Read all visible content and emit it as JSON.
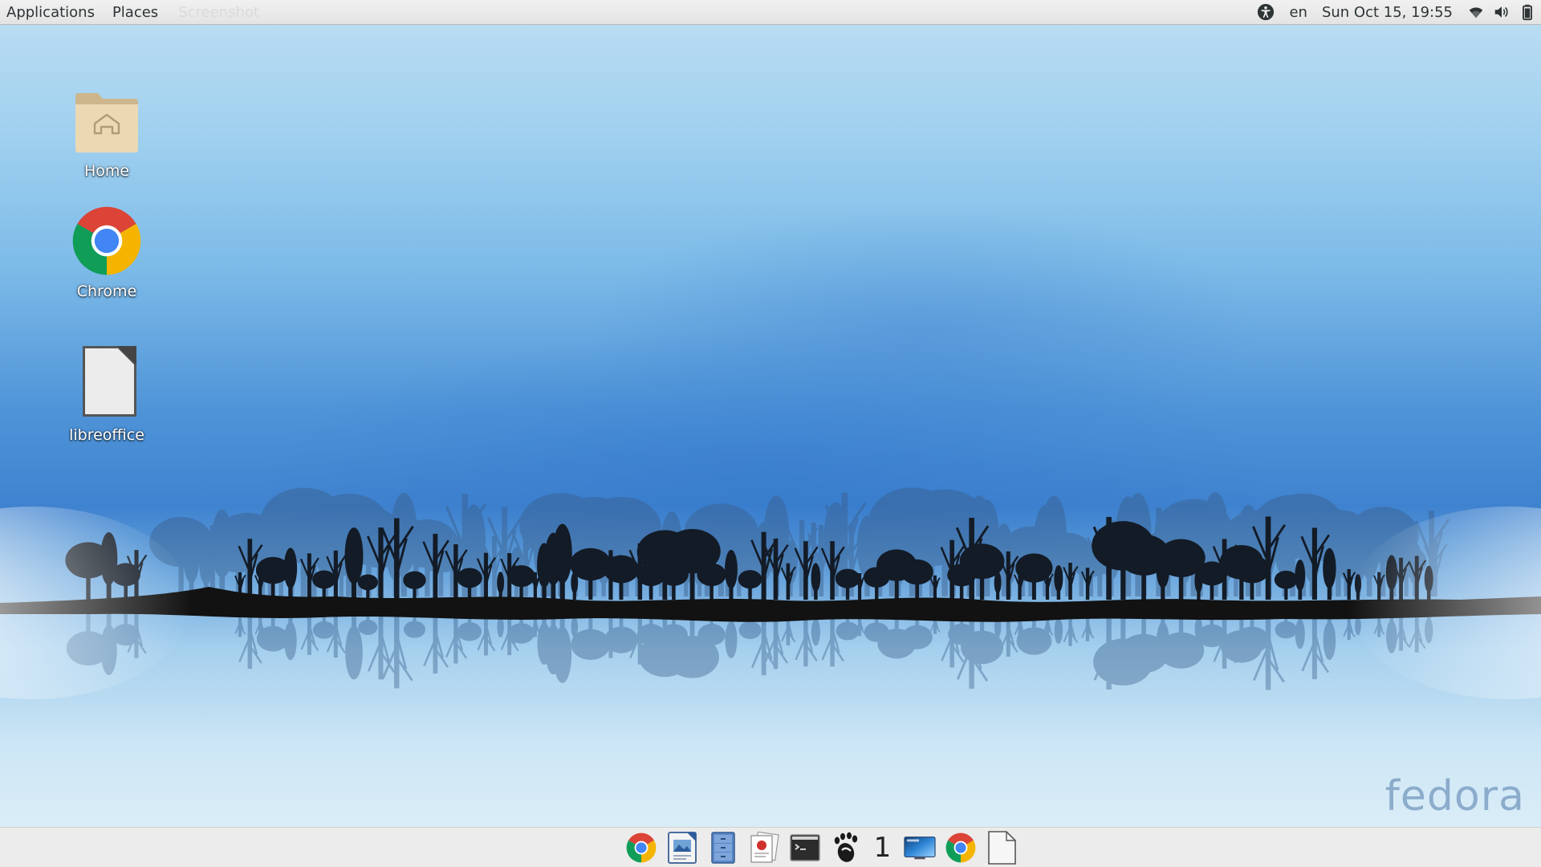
{
  "topbar": {
    "applications_label": "Applications",
    "places_label": "Places",
    "active_app_label": "Screenshot",
    "language": "en",
    "clock": "Sun Oct 15, 19:55",
    "status_icons": [
      "accessibility-icon",
      "wifi-icon",
      "volume-icon",
      "battery-icon"
    ]
  },
  "desktop": {
    "icons": [
      {
        "label": "Home",
        "icon": "home-folder-icon"
      },
      {
        "label": "Chrome",
        "icon": "chrome-icon"
      },
      {
        "label": "libreoffice",
        "icon": "document-icon"
      }
    ],
    "wallpaper_watermark": "fedora"
  },
  "dock": {
    "items": [
      {
        "icon": "chrome-icon"
      },
      {
        "icon": "image-viewer-icon"
      },
      {
        "icon": "file-cabinet-icon"
      },
      {
        "icon": "document-viewer-icon"
      },
      {
        "icon": "terminal-icon"
      },
      {
        "icon": "gnome-foot-icon"
      },
      {
        "icon": "remote-desktop-icon"
      },
      {
        "icon": "chrome-icon"
      },
      {
        "icon": "blank-document-icon"
      }
    ],
    "workspace_number": "1"
  },
  "colors": {
    "topbar_bg": "#ebebeb",
    "topbar_text": "#2e3436",
    "dock_bg": "#ececec",
    "wallpaper_sky": "#7dbbe8",
    "wallpaper_deep": "#3f82cf",
    "silhouette": "#141414"
  }
}
